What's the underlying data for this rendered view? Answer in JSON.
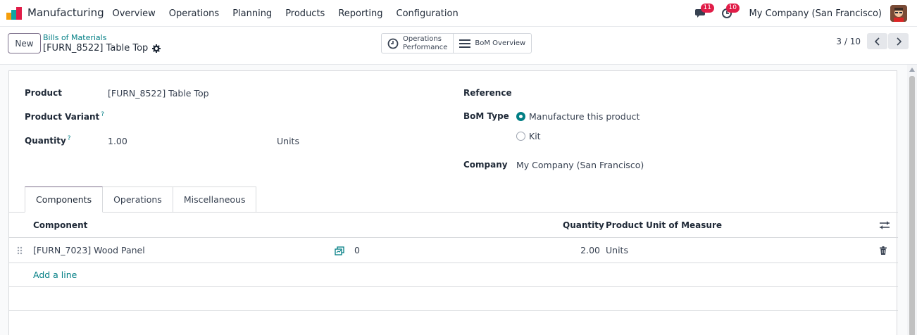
{
  "navbar": {
    "app_name": "Manufacturing",
    "menu": [
      "Overview",
      "Operations",
      "Planning",
      "Products",
      "Reporting",
      "Configuration"
    ],
    "messages_count": "11",
    "activities_count": "10",
    "company": "My Company (San Francisco)"
  },
  "control_panel": {
    "new_label": "New",
    "breadcrumb": "Bills of Materials",
    "record_title": "[FURN_8522] Table Top",
    "smart_buttons": {
      "operations_performance_line1": "Operations",
      "operations_performance_line2": "Performance",
      "bom_overview": "BoM Overview"
    },
    "pager": "3 / 10"
  },
  "form": {
    "product_label": "Product",
    "product_value": "[FURN_8522] Table Top",
    "variant_label": "Product Variant",
    "quantity_label": "Quantity",
    "quantity_value": "1.00",
    "quantity_uom": "Units",
    "tooltip_mark": "?",
    "reference_label": "Reference",
    "bom_type_label": "BoM Type",
    "bom_type_options": [
      {
        "label": "Manufacture this product",
        "selected": true
      },
      {
        "label": "Kit",
        "selected": false
      }
    ],
    "company_label": "Company",
    "company_value": "My Company (San Francisco)"
  },
  "tabs": [
    "Components",
    "Operations",
    "Miscellaneous"
  ],
  "components_table": {
    "headers": {
      "component": "Component",
      "quantity": "Quantity",
      "uom": "Product Unit of Measure"
    },
    "rows": [
      {
        "component": "[FURN_7023] Wood Panel",
        "forecast": "0",
        "quantity": "2.00",
        "uom": "Units"
      }
    ],
    "add_line": "Add a line"
  },
  "colors": {
    "accent": "#017e84",
    "badge": "#e11d48",
    "brand_border": "#7c6f8a"
  }
}
